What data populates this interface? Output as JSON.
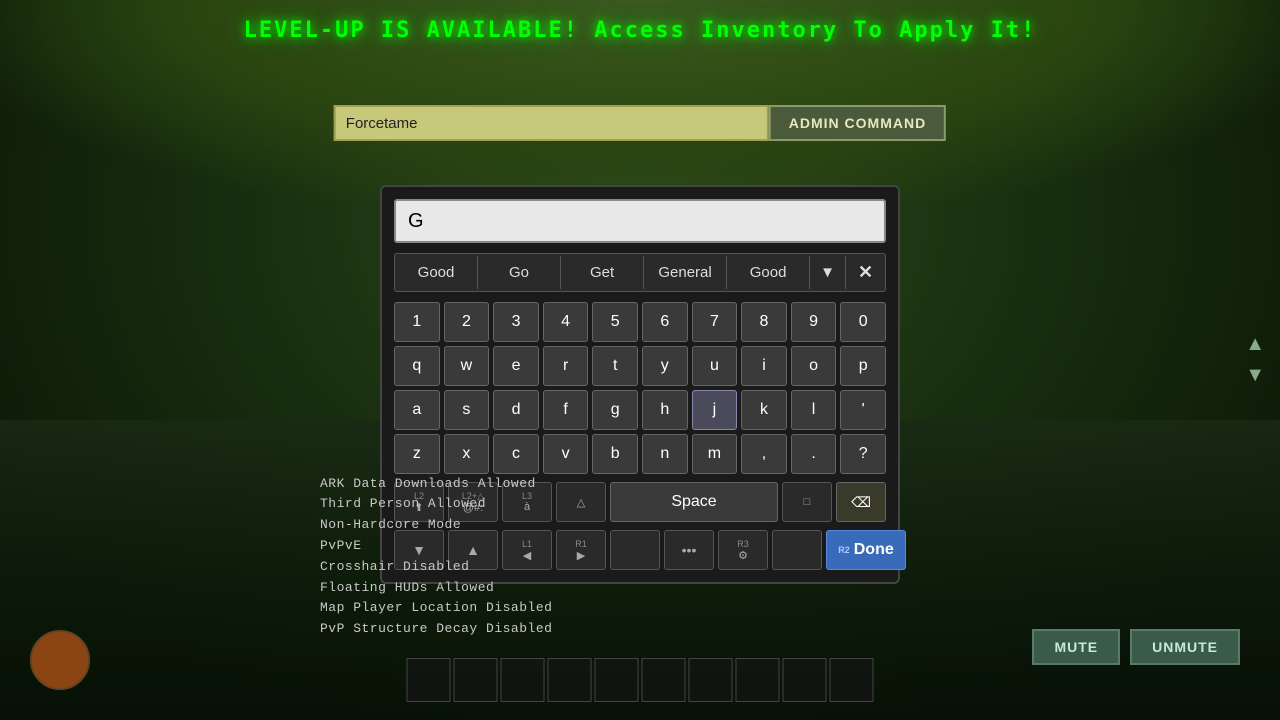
{
  "background": {
    "description": "ARK game background with jungle/forest and water"
  },
  "levelup_bar": {
    "text": "LEVEL-UP IS AVAILABLE!  Access Inventory To Apply It!"
  },
  "admin_bar": {
    "input_value": "Forcetame",
    "button_label": "ADMIN COMMAND"
  },
  "keyboard": {
    "search_input_value": "G",
    "suggestions": [
      "Good",
      "Go",
      "Get",
      "General",
      "Good"
    ],
    "rows": {
      "numbers": [
        "1",
        "2",
        "3",
        "4",
        "5",
        "6",
        "7",
        "8",
        "9",
        "0"
      ],
      "row1": [
        "q",
        "w",
        "e",
        "r",
        "t",
        "y",
        "u",
        "i",
        "o",
        "p"
      ],
      "row2": [
        "a",
        "s",
        "d",
        "f",
        "g",
        "h",
        "j",
        "k",
        "l",
        "'"
      ],
      "row3": [
        "z",
        "x",
        "c",
        "v",
        "b",
        "n",
        "m",
        ",",
        ".",
        "?"
      ]
    },
    "special_keys": {
      "l2_label": "L2",
      "l2_icon": "↑",
      "l2_plus_label": "L2+△",
      "l2_plus_sub": "@#:",
      "l3_label": "L3",
      "l3_sub": "à",
      "triangle_label": "△",
      "square_label": "□",
      "backspace_label": "⌫",
      "space_label": "Space",
      "down_arrow": "▼",
      "up_arrow": "▲",
      "left_arrow": "◀",
      "l1_label": "L1",
      "r1_label": "R1",
      "right_arrow": "▶",
      "dots_label": "•••",
      "r3_label": "R3",
      "r3_icon": "⚙",
      "r2_label": "R2",
      "done_label": "Done"
    }
  },
  "server_info": {
    "lines": [
      "ARK  Data  Downloads  Allowed",
      "Third  Person  Allowed",
      "Non-Hardcore  Mode",
      "PvPvE",
      "Crosshair  Disabled",
      "Floating  HUDs  Allowed",
      "Map  Player  Location  Disabled",
      "PvP  Structure  Decay  Disabled"
    ]
  },
  "mute_controls": {
    "mute_label": "MUTE",
    "unmute_label": "UNMUTE"
  }
}
